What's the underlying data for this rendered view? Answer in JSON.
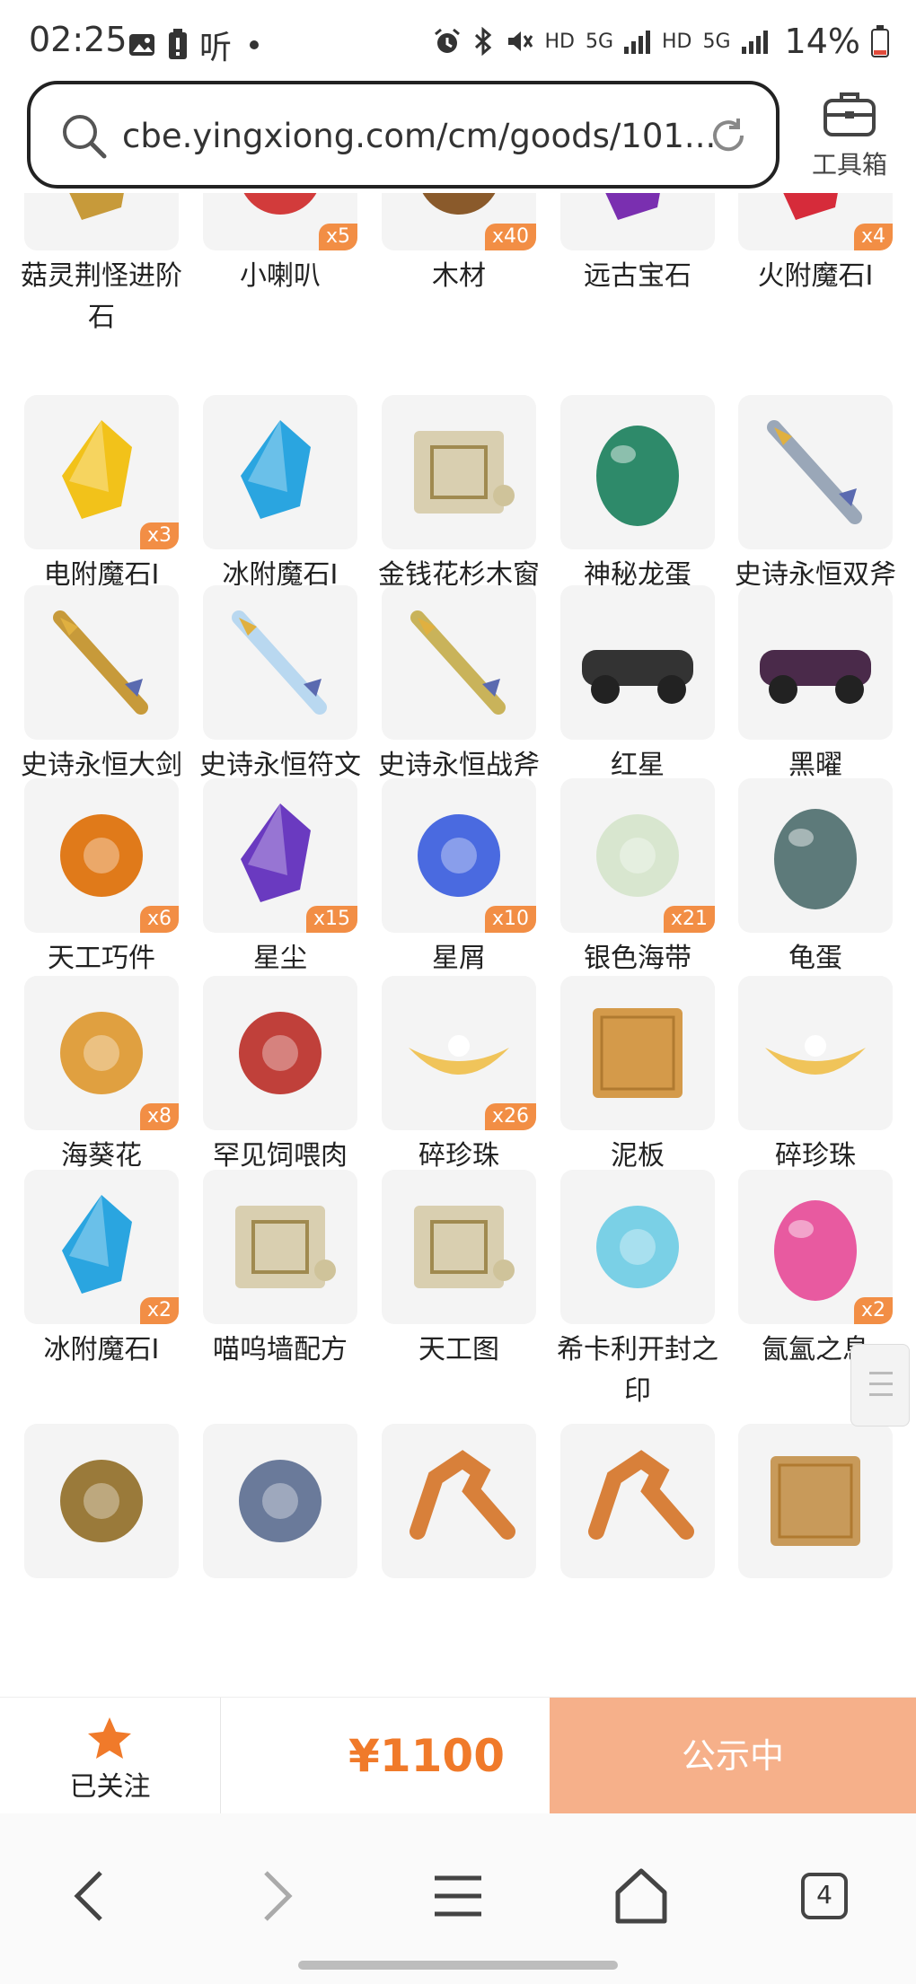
{
  "status_bar": {
    "time": "02:25",
    "carrier_label": "听",
    "battery": "14%",
    "network_labels": [
      "HD",
      "5G",
      "HD",
      "5G"
    ],
    "icons": [
      "gallery-icon",
      "battery-alert-icon",
      "dot-icon",
      "alarm-icon",
      "bluetooth-icon",
      "mute-icon",
      "signal-icon",
      "signal-icon",
      "battery-icon"
    ]
  },
  "browser": {
    "url": "cbe.yingxiong.com/cm/goods/101...",
    "toolbox_label": "工具箱",
    "tab_count": "4"
  },
  "items": [
    {
      "name": "菇灵荆怪进阶石",
      "badge": "",
      "icon": "gem-icon",
      "color": "#c79a3a"
    },
    {
      "name": "小喇叭",
      "badge": "x5",
      "icon": "megaphone-icon",
      "color": "#d23b3b"
    },
    {
      "name": "木材",
      "badge": "x40",
      "icon": "wood-log-icon",
      "color": "#8a5a2b"
    },
    {
      "name": "远古宝石",
      "badge": "",
      "icon": "purple-gem-icon",
      "color": "#7a2fb0"
    },
    {
      "name": "火附魔石Ⅰ",
      "badge": "x4",
      "icon": "red-crystal-icon",
      "color": "#d62b3a"
    },
    {
      "name": "电附魔石Ⅰ",
      "badge": "x3",
      "icon": "yellow-crystal-icon",
      "color": "#f2c21a"
    },
    {
      "name": "冰附魔石Ⅰ",
      "badge": "",
      "icon": "blue-crystal-icon",
      "color": "#2aa5e0"
    },
    {
      "name": "金钱花杉木窗配方",
      "badge": "",
      "icon": "blueprint-scroll-icon",
      "color": "#d9cfb0"
    },
    {
      "name": "神秘龙蛋",
      "badge": "",
      "icon": "dragon-egg-icon",
      "color": "#2e8a6a"
    },
    {
      "name": "史诗永恒双斧",
      "badge": "",
      "icon": "double-axe-icon",
      "color": "#9aa7b8"
    },
    {
      "name": "史诗永恒大剑",
      "badge": "",
      "icon": "greatsword-icon",
      "color": "#c79a3a"
    },
    {
      "name": "史诗永恒符文剑",
      "badge": "",
      "icon": "rune-sword-icon",
      "color": "#b9d8f0"
    },
    {
      "name": "史诗永恒战斧",
      "badge": "",
      "icon": "battle-axe-icon",
      "color": "#c9b35a"
    },
    {
      "name": "红星",
      "badge": "",
      "icon": "motorcycle-icon",
      "color": "#333333"
    },
    {
      "name": "黑曜",
      "badge": "",
      "icon": "car-icon",
      "color": "#4a2a4a"
    },
    {
      "name": "天工巧件",
      "badge": "x6",
      "icon": "gadget-icon",
      "color": "#e07a1a"
    },
    {
      "name": "星尘",
      "badge": "x15",
      "icon": "star-crystal-icon",
      "color": "#6a3ac0"
    },
    {
      "name": "星屑",
      "badge": "x10",
      "icon": "star-shard-icon",
      "color": "#4a6ae0"
    },
    {
      "name": "银色海带",
      "badge": "x21",
      "icon": "seaweed-icon",
      "color": "#d8e6cf"
    },
    {
      "name": "龟蛋",
      "badge": "",
      "icon": "turtle-egg-icon",
      "color": "#5d7a7a"
    },
    {
      "name": "海葵花",
      "badge": "x8",
      "icon": "anemone-icon",
      "color": "#e0a040"
    },
    {
      "name": "罕见饲喂肉",
      "badge": "",
      "icon": "meat-icon",
      "color": "#c0403a"
    },
    {
      "name": "碎珍珠",
      "badge": "x26",
      "icon": "pearl-shell-icon",
      "color": "#f0c45a"
    },
    {
      "name": "泥板",
      "badge": "",
      "icon": "clay-tablet-icon",
      "color": "#d49a4a"
    },
    {
      "name": "碎珍珠",
      "badge": "",
      "icon": "pearl-shell-icon",
      "color": "#f0c45a"
    },
    {
      "name": "冰附魔石Ⅰ",
      "badge": "x2",
      "icon": "blue-crystal-icon",
      "color": "#2aa5e0"
    },
    {
      "name": "喵呜墙配方",
      "badge": "",
      "icon": "blueprint-scroll-icon",
      "color": "#d9cfb0"
    },
    {
      "name": "天工图",
      "badge": "",
      "icon": "blueprint-scroll-icon",
      "color": "#d9cfb0"
    },
    {
      "name": "希卡利开封之印",
      "badge": "",
      "icon": "seal-icon",
      "color": "#7ad0e6"
    },
    {
      "name": "氤氳之息",
      "badge": "x2",
      "icon": "orb-icon",
      "color": "#e85aa0"
    },
    {
      "name": "",
      "badge": "",
      "icon": "fish-icon",
      "color": "#9a7a3a"
    },
    {
      "name": "",
      "badge": "",
      "icon": "furnace-icon",
      "color": "#6a7a9a"
    },
    {
      "name": "",
      "badge": "",
      "icon": "horse-icon",
      "color": "#d8803a"
    },
    {
      "name": "",
      "badge": "",
      "icon": "horse-icon",
      "color": "#d8803a"
    },
    {
      "name": "",
      "badge": "",
      "icon": "box-icon",
      "color": "#c89a5a"
    }
  ],
  "action_bar": {
    "follow_label": "已关注",
    "price": "¥1100",
    "status_label": "公示中",
    "price_color": "#f07a2a",
    "status_bg": "#f6b08a"
  },
  "nav": {
    "icons": [
      "back-icon",
      "forward-icon",
      "menu-icon",
      "home-icon",
      "tabs-icon"
    ]
  }
}
